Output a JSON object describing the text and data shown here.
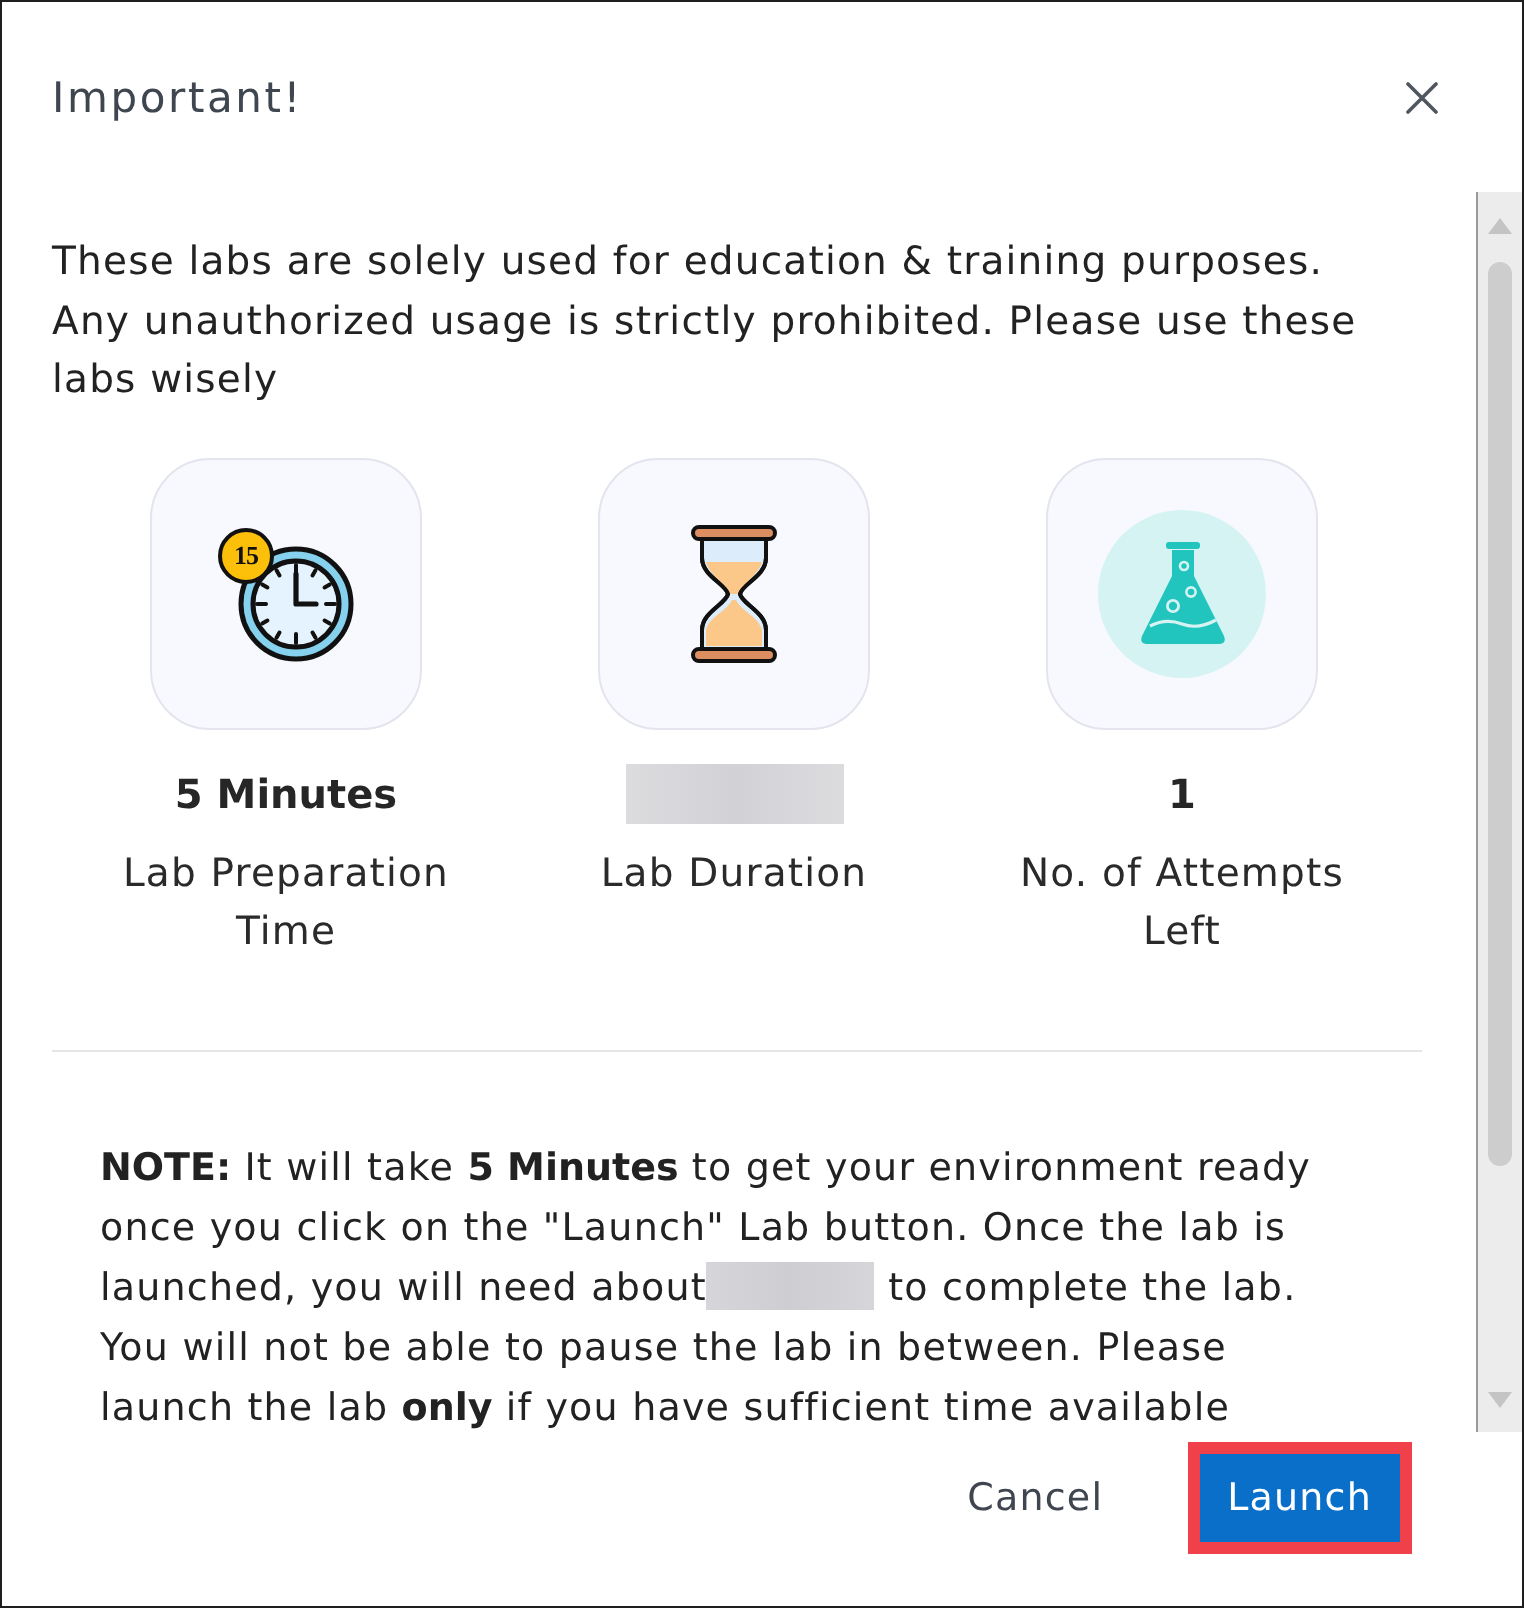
{
  "dialog": {
    "title": "Important!"
  },
  "intro": "These labs are solely used for education & training purposes. Any unauthorized usage is strictly prohibited. Please use these labs wisely",
  "stats": [
    {
      "badge": "15",
      "value": "5 Minutes",
      "redacted": false,
      "label": "Lab Preparation Time"
    },
    {
      "redacted": true,
      "label": "Lab Duration"
    },
    {
      "value": "1",
      "redacted": false,
      "label": "No. of Attempts Left"
    }
  ],
  "note": {
    "parts": [
      {
        "kind": "text",
        "text": "**NOTE:** It will take **5 Minutes** to get your environment ready once you click on the \"Launch\" Lab button. Once the lab is launched, you will need about"
      },
      {
        "kind": "redacted"
      },
      {
        "kind": "text",
        "text": " to complete the lab. You will not be able to pause the lab in between. Please launch the lab **only** if you have sufficient time available"
      }
    ]
  },
  "buttons": [
    {
      "label": "Cancel",
      "kind": "secondary",
      "highlighted": false
    },
    {
      "label": "Launch",
      "kind": "primary",
      "highlighted": true
    }
  ]
}
